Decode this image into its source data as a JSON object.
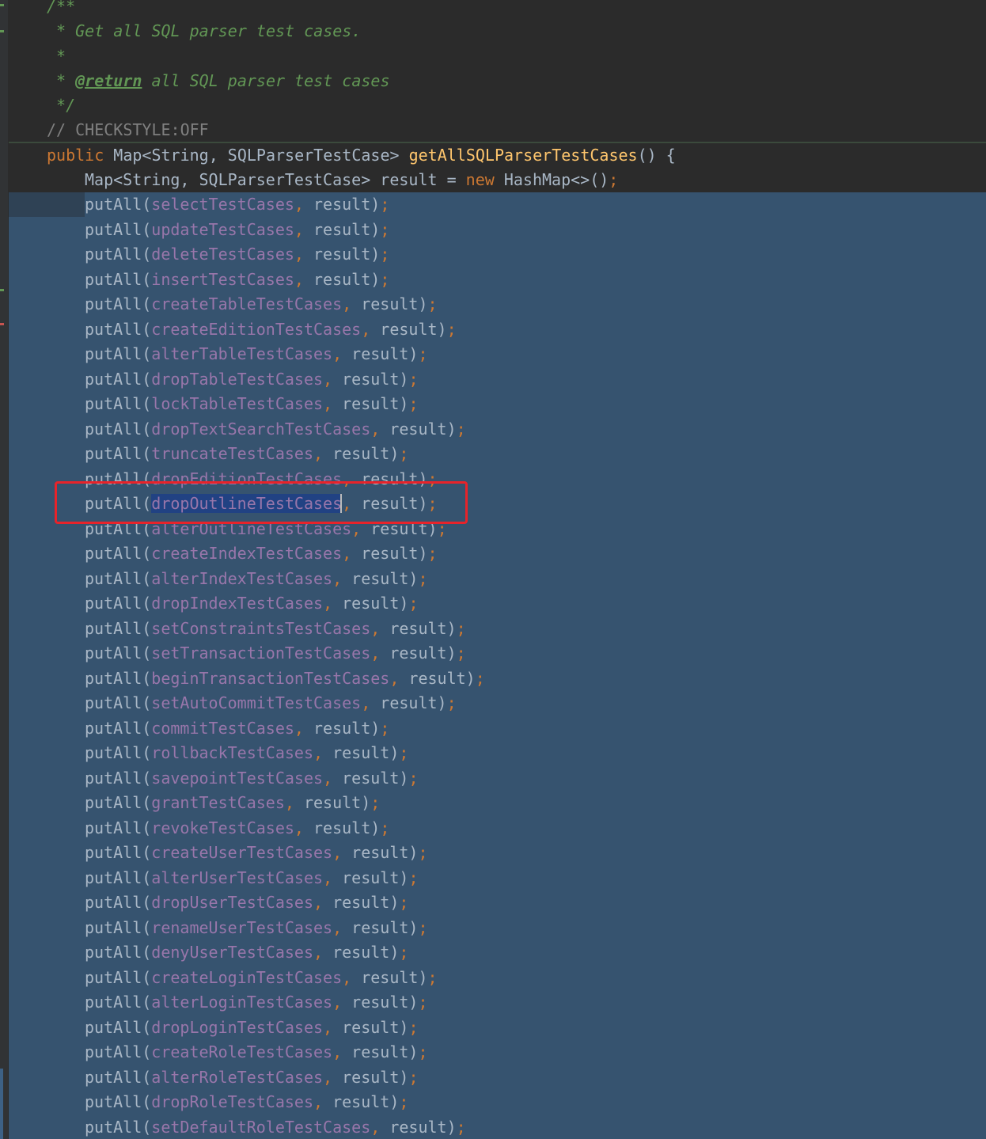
{
  "editor": {
    "doc_comment": {
      "open": "/**",
      "summary": " * Get all SQL parser test cases.",
      "blank": " *",
      "return_prefix": " * ",
      "return_tag": "@return",
      "return_text": " all SQL parser test cases",
      "close": " */"
    },
    "checkstyle_comment": "// CHECKSTYLE:OFF",
    "signature": {
      "modifier": "public",
      "return_type": "Map<String, SQLParserTestCase>",
      "method_name": "getAllSQLParserTestCases",
      "tail": "() {"
    },
    "decl": {
      "type": "Map<String, SQLParserTestCase>",
      "var": "result",
      "eq": "=",
      "kw_new": "new",
      "ctor": "HashMap<>()",
      "semi": ";"
    },
    "call_name": "putAll",
    "call_arg2": "result",
    "put_all_fields": [
      "selectTestCases",
      "updateTestCases",
      "deleteTestCases",
      "insertTestCases",
      "createTableTestCases",
      "createEditionTestCases",
      "alterTableTestCases",
      "dropTableTestCases",
      "lockTableTestCases",
      "dropTextSearchTestCases",
      "truncateTestCases",
      "dropEditionTestCases",
      "dropOutlineTestCases",
      "alterOutlineTestCases",
      "createIndexTestCases",
      "alterIndexTestCases",
      "dropIndexTestCases",
      "setConstraintsTestCases",
      "setTransactionTestCases",
      "beginTransactionTestCases",
      "setAutoCommitTestCases",
      "commitTestCases",
      "rollbackTestCases",
      "savepointTestCases",
      "grantTestCases",
      "revokeTestCases",
      "createUserTestCases",
      "alterUserTestCases",
      "dropUserTestCases",
      "renameUserTestCases",
      "denyUserTestCases",
      "createLoginTestCases",
      "alterLoginTestCases",
      "dropLoginTestCases",
      "createRoleTestCases",
      "alterRoleTestCases",
      "dropRoleTestCases",
      "setDefaultRoleTestCases"
    ],
    "highlighted_field": "dropOutlineTestCases"
  },
  "colors": {
    "background": "#2b2b2b",
    "selection": "#36536f",
    "keyword": "#cc7832",
    "method": "#ffc66d",
    "field": "#9876aa",
    "doc_comment": "#629755",
    "highlight_box": "#e8232a"
  }
}
